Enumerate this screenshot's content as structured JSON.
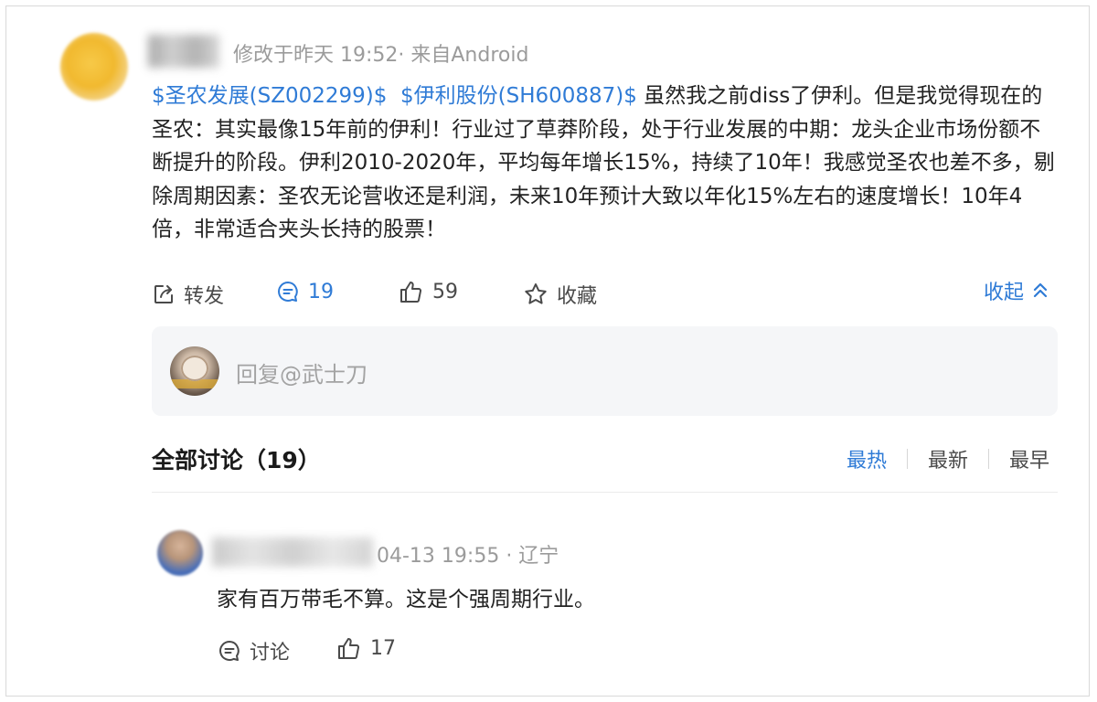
{
  "post": {
    "meta": "修改于昨天 19:52· 来自Android",
    "tag1": "$圣农发展(SZ002299)$",
    "tag2": "$伊利股份(SH600887)$",
    "body": "虽然我之前diss了伊利。但是我觉得现在的圣农：其实最像15年前的伊利！行业过了草莽阶段，处于行业发展的中期：龙头企业市场份额不断提升的阶段。伊利2010-2020年，平均每年增长15%，持续了10年！我感觉圣农也差不多，剔除周期因素：圣农无论营收还是利润，未来10年预计大致以年化15%左右的速度增长！10年4倍，非常适合夹头长持的股票！"
  },
  "actions": {
    "repost": "转发",
    "comments": "19",
    "likes": "59",
    "favorite": "收藏",
    "collapse": "收起"
  },
  "reply": {
    "placeholder": "回复@武士刀"
  },
  "discussion": {
    "title": "全部讨论（19）",
    "sort_hot": "最热",
    "sort_new": "最新",
    "sort_early": "最早"
  },
  "comment": {
    "meta": "04-13 19:55 · 辽宁",
    "text": "家有百万带毛不算。这是个强周期行业。",
    "discuss": "讨论",
    "likes": "17"
  },
  "colors": {
    "link": "#2f7bd6",
    "muted": "#9b9b9b",
    "reply_bg": "#f5f6f8"
  }
}
